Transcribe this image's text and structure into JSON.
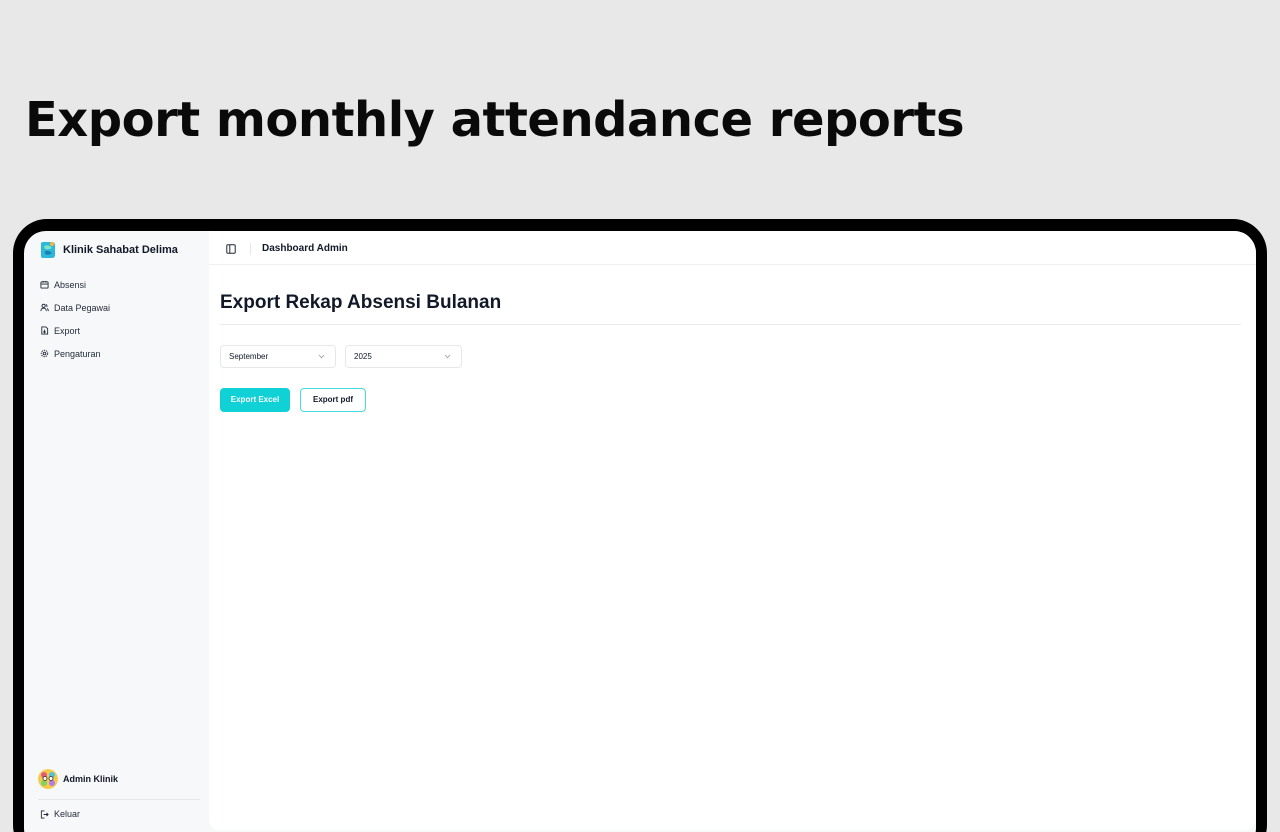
{
  "hero": {
    "title": "Export monthly attendance reports"
  },
  "sidebar": {
    "brand": "Klinik Sahabat Delima",
    "items": [
      {
        "label": "Absensi",
        "icon": "calendar-icon"
      },
      {
        "label": "Data Pegawai",
        "icon": "users-icon"
      },
      {
        "label": "Export",
        "icon": "file-export-icon"
      },
      {
        "label": "Pengaturan",
        "icon": "gear-icon"
      }
    ],
    "user": {
      "name": "Admin Klinik",
      "icon": "avatar"
    },
    "logout": {
      "label": "Keluar",
      "icon": "logout-icon"
    }
  },
  "topbar": {
    "title": "Dashboard Admin",
    "toggle_icon": "panel-left-icon"
  },
  "main": {
    "page_title": "Export Rekap Absensi Bulanan",
    "month_select": {
      "value": "September"
    },
    "year_select": {
      "value": "2025"
    },
    "export_excel_label": "Export Excel",
    "export_pdf_label": "Export pdf"
  },
  "colors": {
    "accent": "#0fd1d6",
    "sidebar_bg": "#f7f8fa",
    "text": "#111827"
  }
}
